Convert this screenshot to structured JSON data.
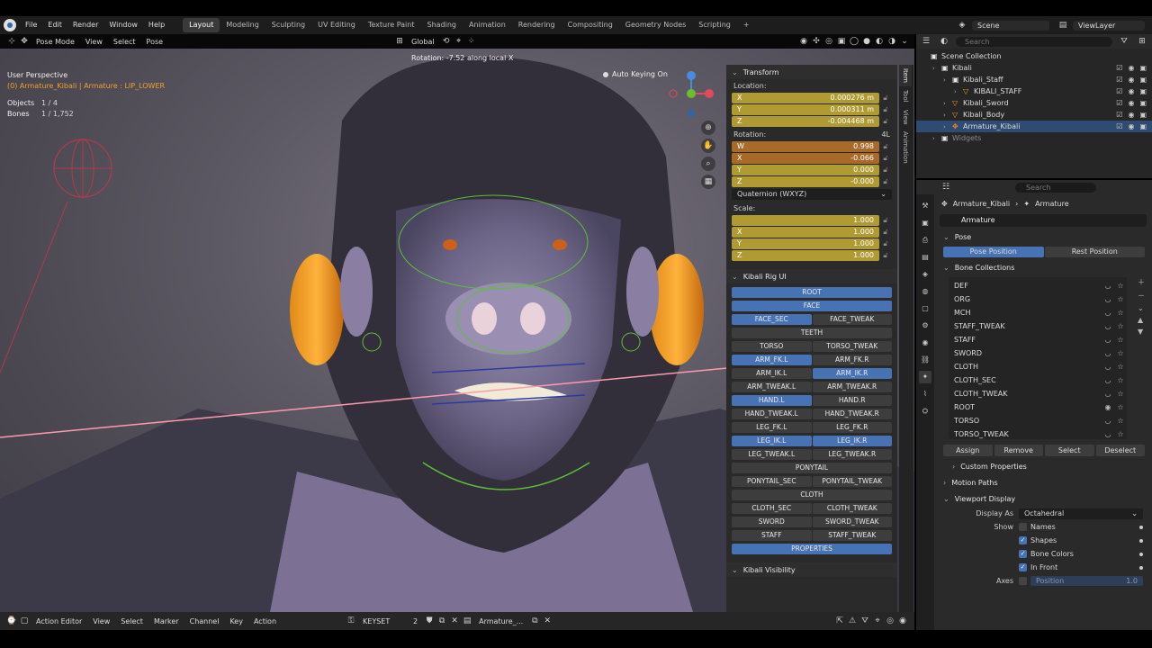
{
  "menubar": {
    "items": [
      "File",
      "Edit",
      "Render",
      "Window",
      "Help"
    ],
    "workspaces": [
      "Layout",
      "Modeling",
      "Sculpting",
      "UV Editing",
      "Texture Paint",
      "Shading",
      "Animation",
      "Rendering",
      "Compositing",
      "Geometry Nodes",
      "Scripting"
    ],
    "active_workspace": "Layout",
    "add_tab": "+",
    "scene": "Scene",
    "view_layer": "ViewLayer"
  },
  "viewport_header": {
    "mode": "Pose Mode",
    "menus": [
      "View",
      "Select",
      "Pose"
    ],
    "orientation": "Global"
  },
  "viewport": {
    "perspective": "User Perspective",
    "active_info": "(0) Armature_Kibali | Armature : LIP_LOWER",
    "objects_label": "Objects",
    "objects_value": "1 / 4",
    "bones_label": "Bones",
    "bones_value": "1 / 1,752",
    "operator_msg": "Rotation: -7.52 along local X",
    "auto_keying": "Auto Keying On"
  },
  "npanel": {
    "transform_title": "Transform",
    "location_label": "Location:",
    "location": [
      {
        "axis": "X",
        "value": "0.000276 m"
      },
      {
        "axis": "Y",
        "value": "0.000311 m"
      },
      {
        "axis": "Z",
        "value": "-0.004468 m"
      }
    ],
    "rotation_label": "Rotation:",
    "rotation_mode_tag": "4L",
    "rotation": [
      {
        "axis": "W",
        "value": "0.998"
      },
      {
        "axis": "X",
        "value": "-0.066"
      },
      {
        "axis": "Y",
        "value": "0.000"
      },
      {
        "axis": "Z",
        "value": "-0.000"
      }
    ],
    "rotation_mode": "Quaternion (WXYZ)",
    "scale_label": "Scale:",
    "scale": [
      {
        "axis": "",
        "value": "1.000"
      },
      {
        "axis": "X",
        "value": "1.000"
      },
      {
        "axis": "Y",
        "value": "1.000"
      },
      {
        "axis": "Z",
        "value": "1.000"
      }
    ],
    "rig_title": "Kibali Rig UI",
    "rig_rows": [
      [
        {
          "label": "ROOT",
          "on": true
        }
      ],
      [
        {
          "label": "FACE",
          "on": true
        }
      ],
      [
        {
          "label": "FACE_SEC",
          "on": true
        },
        {
          "label": "FACE_TWEAK",
          "on": false
        }
      ],
      [
        {
          "label": "TEETH",
          "on": false
        }
      ],
      [
        {
          "label": "TORSO",
          "on": false
        },
        {
          "label": "TORSO_TWEAK",
          "on": false
        }
      ],
      [
        {
          "label": "ARM_FK.L",
          "on": true
        },
        {
          "label": "ARM_FK.R",
          "on": false
        }
      ],
      [
        {
          "label": "ARM_IK.L",
          "on": false
        },
        {
          "label": "ARM_IK.R",
          "on": true
        }
      ],
      [
        {
          "label": "ARM_TWEAK.L",
          "on": false
        },
        {
          "label": "ARM_TWEAK.R",
          "on": false
        }
      ],
      [
        {
          "label": "HAND.L",
          "on": true
        },
        {
          "label": "HAND.R",
          "on": false
        }
      ],
      [
        {
          "label": "HAND_TWEAK.L",
          "on": false
        },
        {
          "label": "HAND_TWEAK.R",
          "on": false
        }
      ],
      [
        {
          "label": "LEG_FK.L",
          "on": false
        },
        {
          "label": "LEG_FK.R",
          "on": false
        }
      ],
      [
        {
          "label": "LEG_IK.L",
          "on": true
        },
        {
          "label": "LEG_IK.R",
          "on": true
        }
      ],
      [
        {
          "label": "LEG_TWEAK.L",
          "on": false
        },
        {
          "label": "LEG_TWEAK.R",
          "on": false
        }
      ],
      [
        {
          "label": "PONYTAIL",
          "on": false
        }
      ],
      [
        {
          "label": "PONYTAIL_SEC",
          "on": false
        },
        {
          "label": "PONYTAIL_TWEAK",
          "on": false
        }
      ],
      [
        {
          "label": "CLOTH",
          "on": false
        }
      ],
      [
        {
          "label": "CLOTH_SEC",
          "on": false
        },
        {
          "label": "CLOTH_TWEAK",
          "on": false
        }
      ],
      [
        {
          "label": "SWORD",
          "on": false
        },
        {
          "label": "SWORD_TWEAK",
          "on": false
        }
      ],
      [
        {
          "label": "STAFF",
          "on": false
        },
        {
          "label": "STAFF_TWEAK",
          "on": false
        }
      ],
      [
        {
          "label": "PROPERTIES",
          "on": true
        }
      ]
    ],
    "visibility_title": "Kibali Visibility",
    "tabs": [
      "Item",
      "Tool",
      "View",
      "Animation"
    ]
  },
  "outliner": {
    "search_placeholder": "Search",
    "rows": [
      {
        "indent": 0,
        "name": "Scene Collection",
        "icon": "collection-icon",
        "vis": false,
        "sel": false
      },
      {
        "indent": 1,
        "name": "Kibali",
        "icon": "collection-icon",
        "vis": true,
        "sel": false
      },
      {
        "indent": 2,
        "name": "Kibali_Staff",
        "icon": "collection-icon",
        "vis": true,
        "sel": false
      },
      {
        "indent": 3,
        "name": "KIBALI_STAFF",
        "icon": "mesh-icon",
        "vis": true,
        "sel": false
      },
      {
        "indent": 2,
        "name": "Kibali_Sword",
        "icon": "mesh-icon",
        "vis": true,
        "sel": false
      },
      {
        "indent": 2,
        "name": "Kibali_Body",
        "icon": "mesh-icon",
        "vis": true,
        "sel": false
      },
      {
        "indent": 2,
        "name": "Armature_Kibali",
        "icon": "armature-icon",
        "vis": true,
        "sel": true
      },
      {
        "indent": 1,
        "name": "Widgets",
        "icon": "collection-icon",
        "vis": false,
        "sel": false
      }
    ]
  },
  "properties": {
    "search_placeholder": "Search",
    "breadcrumb_object": "Armature_Kibali",
    "breadcrumb_data": "Armature",
    "data_name": "Armature",
    "pose_section": "Pose",
    "pose_position": "Pose Position",
    "rest_position": "Rest Position",
    "bone_collections_section": "Bone Collections",
    "bone_collections": [
      "DEF",
      "ORG",
      "MCH",
      "STAFF_TWEAK",
      "STAFF",
      "SWORD",
      "CLOTH",
      "CLOTH_SEC",
      "CLOTH_TWEAK",
      "ROOT",
      "TORSO",
      "TORSO_TWEAK"
    ],
    "bc_actions": [
      "Assign",
      "Remove",
      "Select",
      "Deselect"
    ],
    "custom_properties": "Custom Properties",
    "motion_paths": "Motion Paths",
    "viewport_display": "Viewport Display",
    "display_as_label": "Display As",
    "display_as_value": "Octahedral",
    "show_label": "Show",
    "show_options": [
      {
        "label": "Names",
        "on": false
      },
      {
        "label": "Shapes",
        "on": true
      },
      {
        "label": "Bone Colors",
        "on": true
      },
      {
        "label": "In Front",
        "on": true
      }
    ],
    "axes_label": "Axes",
    "axes_position_label": "Position",
    "axes_position_value": "1.0"
  },
  "action_editor": {
    "mode": "Action Editor",
    "menus": [
      "View",
      "Select",
      "Marker",
      "Channel",
      "Key",
      "Action"
    ],
    "keyset": "KEYSET",
    "keyset_users": "2",
    "action_name": "Armature_..."
  }
}
